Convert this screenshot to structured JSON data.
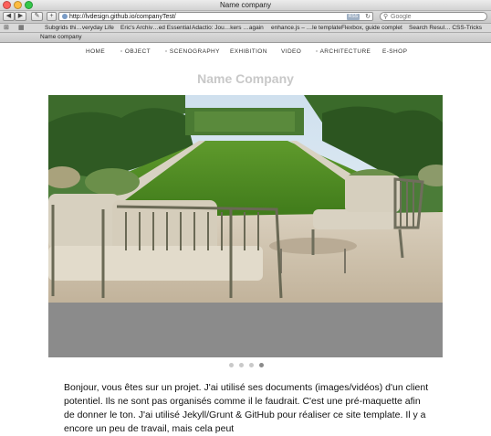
{
  "window": {
    "title": "Name company"
  },
  "toolbar": {
    "back_label": "◀",
    "forward_label": "▶",
    "edit_label": "✎",
    "new_tab_label": "+",
    "url": "http://lvdesign.github.io/companyTest/",
    "rss_label": "RSS",
    "search_placeholder": "Google"
  },
  "bookmarks": {
    "items": [
      "Subgrids thi…veryday Life",
      "Eric's Archiv…ed Essential",
      "Adactio: Jou…kers …again",
      "enhance.js – …le template",
      "Flexbox, guide complet",
      "Search Resul… CSS-Tricks"
    ]
  },
  "tab": {
    "label": "Name company"
  },
  "nav": {
    "items": [
      "HOME",
      "OBJECT",
      "SCENOGRAPHY",
      "EXHIBITION",
      "VIDEO",
      "ARCHITECTURE",
      "E-SHOP"
    ]
  },
  "page": {
    "title": "Name Company",
    "intro": "Bonjour, vous êtes sur un projet. J'ai utilisé ses documents (images/vidéos) d'un client potentiel. Ils ne sont pas organisés comme il le faudrait. C'est une pré-maquette afin de donner le ton. J'ai utilisé Jekyll/Grunt & GitHub pour réaliser ce site template. Il y a encore un peu de travail, mais cela peut"
  },
  "carousel": {
    "slide_count": 4,
    "active_index": 3
  },
  "colors": {
    "title_gray": "#c8c8c8",
    "carousel_bg": "#8b8b8b",
    "dot_active": "#8a8a8a",
    "dot_inactive": "#c9c9c9"
  }
}
